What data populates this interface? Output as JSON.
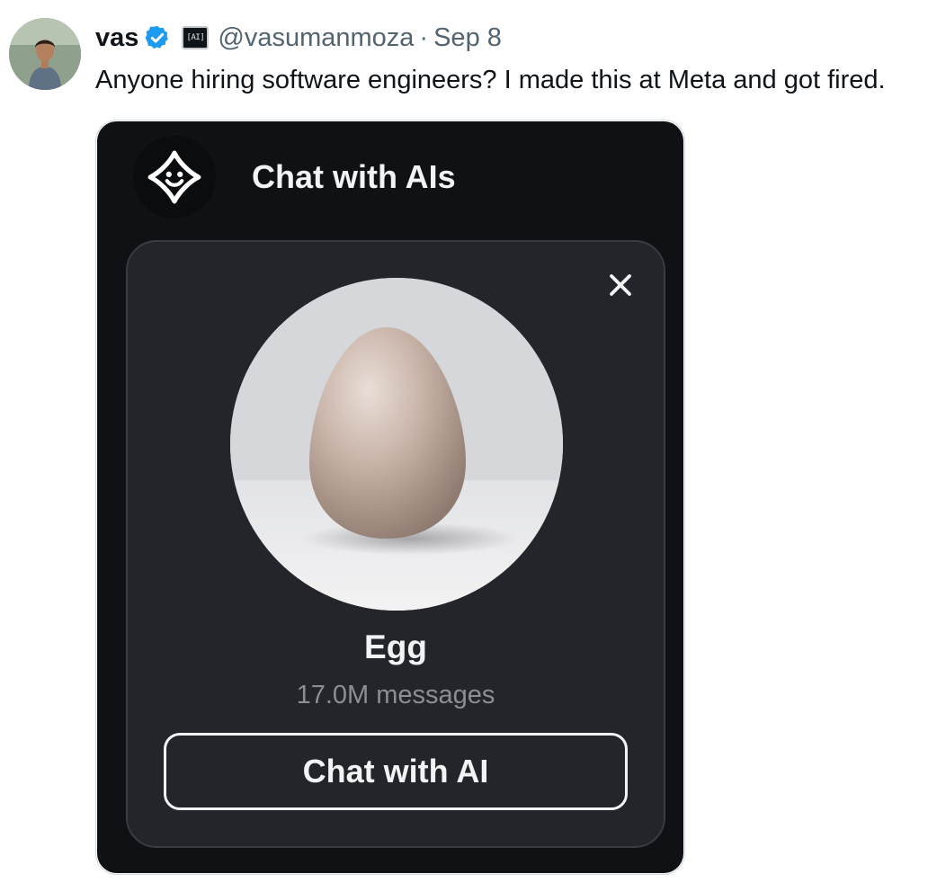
{
  "tweet": {
    "author": {
      "display_name": "vas",
      "handle": "@vasumanmoza",
      "affiliation_badge": "[AI]",
      "separator": "·",
      "date": "Sep 8",
      "verified_color": "#1d9bf0"
    },
    "text": "Anyone hiring software engineers? I made this at Meta and got fired."
  },
  "media": {
    "app_title": "Chat with AIs",
    "card": {
      "ai_name": "Egg",
      "message_count": "17.0M messages",
      "cta_label": "Chat with AI"
    }
  },
  "icons": {
    "verified": "verified-check-icon",
    "close": "close-icon",
    "app_logo": "smiley-sparkle-icon"
  }
}
